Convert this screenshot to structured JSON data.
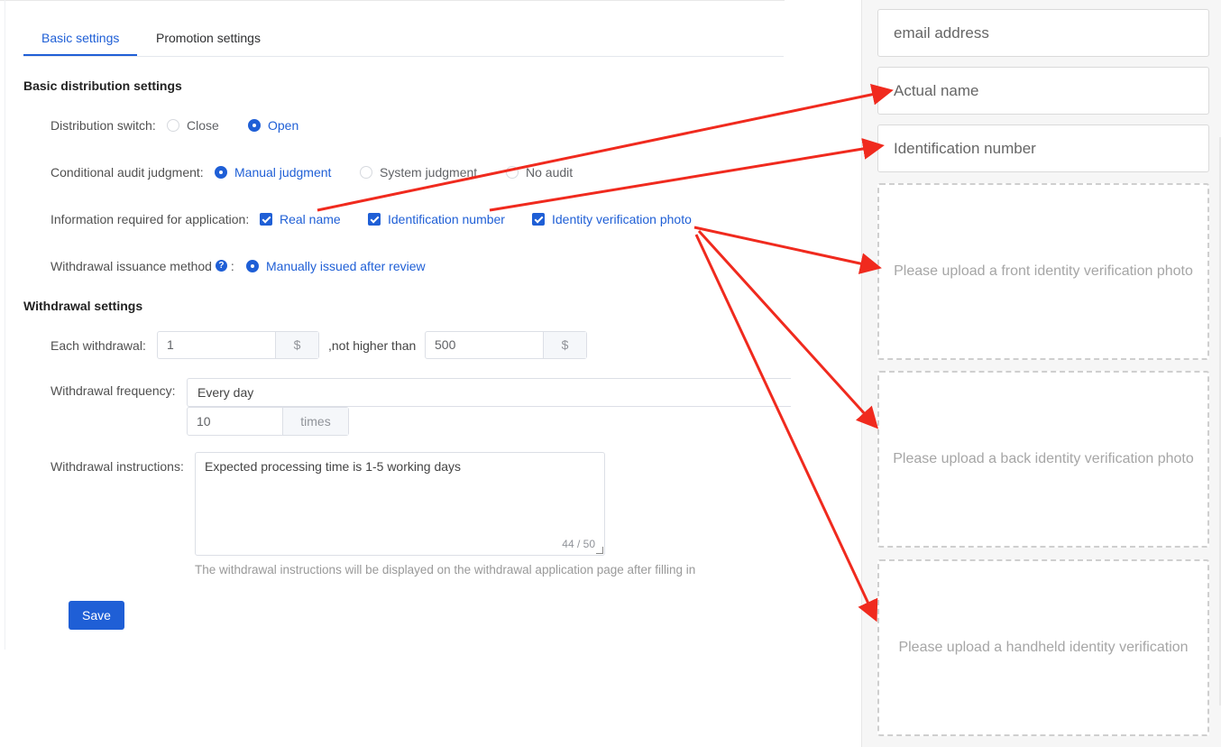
{
  "tabs": [
    {
      "label": "Basic settings",
      "active": true
    },
    {
      "label": "Promotion settings",
      "active": false
    }
  ],
  "basic": {
    "title": "Basic distribution settings",
    "distribution_switch": {
      "label": "Distribution switch:",
      "options": [
        "Close",
        "Open"
      ],
      "selected": "Open"
    },
    "audit": {
      "label": "Conditional audit judgment:",
      "options": [
        "Manual judgment",
        "System judgment",
        "No audit"
      ],
      "selected": "Manual judgment"
    },
    "info_required": {
      "label": "Information required for application:",
      "options": [
        "Real name",
        "Identification number",
        "Identity verification photo"
      ],
      "checked": [
        true,
        true,
        true
      ]
    },
    "issuance": {
      "label": "Withdrawal issuance method",
      "colon": ":",
      "help_icon": "question-circle-icon",
      "option": "Manually issued after review"
    }
  },
  "withdrawal": {
    "title": "Withdrawal settings",
    "each": {
      "label": "Each withdrawal:",
      "min_value": "1",
      "unit": "$",
      "connector": ",not higher than",
      "max_value": "500",
      "max_unit": "$"
    },
    "frequency": {
      "label": "Withdrawal frequency:",
      "period": "Every day",
      "count": "10",
      "count_unit": "times"
    },
    "instructions": {
      "label": "Withdrawal instructions:",
      "value": "Expected processing time is 1-5 working days",
      "counter": "44 / 50",
      "hint": "The withdrawal instructions will be displayed on the withdrawal application page after filling in"
    },
    "save_label": "Save"
  },
  "preview": {
    "fields": [
      "email address",
      "Actual name",
      "Identification number"
    ],
    "uploads": [
      "Please upload a front identity verification photo",
      "Please upload a back identity verification photo",
      "Please upload a handheld identity verification"
    ]
  },
  "colors": {
    "primary": "#1f5fd6",
    "arrow": "#f02a1e"
  }
}
